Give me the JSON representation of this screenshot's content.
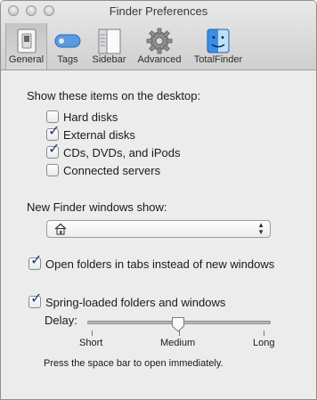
{
  "window": {
    "title": "Finder Preferences"
  },
  "toolbar": {
    "items": [
      {
        "label": "General",
        "icon": "general-switch-icon",
        "selected": true
      },
      {
        "label": "Tags",
        "icon": "tag-icon",
        "selected": false
      },
      {
        "label": "Sidebar",
        "icon": "sidebar-icon",
        "selected": false
      },
      {
        "label": "Advanced",
        "icon": "gear-icon",
        "selected": false
      },
      {
        "label": "TotalFinder",
        "icon": "totalfinder-icon",
        "selected": false
      }
    ]
  },
  "desktop_items": {
    "heading": "Show these items on the desktop:",
    "options": [
      {
        "label": "Hard disks",
        "checked": false
      },
      {
        "label": "External disks",
        "checked": true
      },
      {
        "label": "CDs, DVDs, and iPods",
        "checked": true
      },
      {
        "label": "Connected servers",
        "checked": false
      }
    ]
  },
  "new_window": {
    "heading": "New Finder windows show:",
    "selected_value": "",
    "icon": "home-icon"
  },
  "tabs_option": {
    "label": "Open folders in tabs instead of new windows",
    "checked": true
  },
  "spring_loaded": {
    "label": "Spring-loaded folders and windows",
    "checked": true,
    "delay_label": "Delay:",
    "slider_value": 0.5,
    "tick_labels": [
      "Short",
      "Medium",
      "Long"
    ],
    "hint": "Press the space bar to open immediately."
  },
  "colors": {
    "checkmark": "#1d3b7a",
    "window_bg": "#ececec"
  }
}
